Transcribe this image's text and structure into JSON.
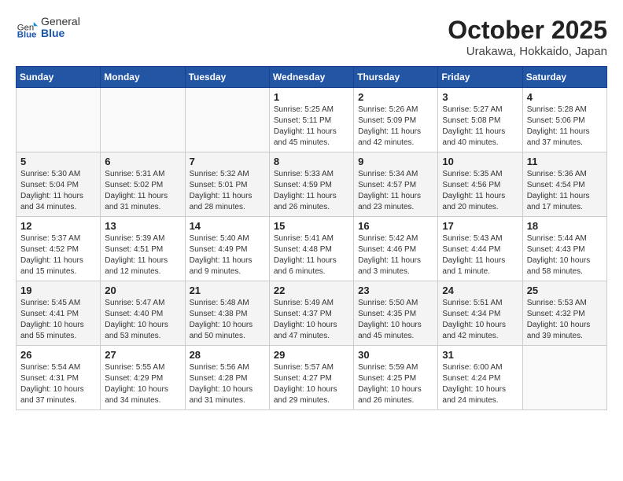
{
  "header": {
    "logo_general": "General",
    "logo_blue": "Blue",
    "title": "October 2025",
    "location": "Urakawa, Hokkaido, Japan"
  },
  "weekdays": [
    "Sunday",
    "Monday",
    "Tuesday",
    "Wednesday",
    "Thursday",
    "Friday",
    "Saturday"
  ],
  "weeks": [
    [
      {
        "day": "",
        "info": ""
      },
      {
        "day": "",
        "info": ""
      },
      {
        "day": "",
        "info": ""
      },
      {
        "day": "1",
        "info": "Sunrise: 5:25 AM\nSunset: 5:11 PM\nDaylight: 11 hours\nand 45 minutes."
      },
      {
        "day": "2",
        "info": "Sunrise: 5:26 AM\nSunset: 5:09 PM\nDaylight: 11 hours\nand 42 minutes."
      },
      {
        "day": "3",
        "info": "Sunrise: 5:27 AM\nSunset: 5:08 PM\nDaylight: 11 hours\nand 40 minutes."
      },
      {
        "day": "4",
        "info": "Sunrise: 5:28 AM\nSunset: 5:06 PM\nDaylight: 11 hours\nand 37 minutes."
      }
    ],
    [
      {
        "day": "5",
        "info": "Sunrise: 5:30 AM\nSunset: 5:04 PM\nDaylight: 11 hours\nand 34 minutes."
      },
      {
        "day": "6",
        "info": "Sunrise: 5:31 AM\nSunset: 5:02 PM\nDaylight: 11 hours\nand 31 minutes."
      },
      {
        "day": "7",
        "info": "Sunrise: 5:32 AM\nSunset: 5:01 PM\nDaylight: 11 hours\nand 28 minutes."
      },
      {
        "day": "8",
        "info": "Sunrise: 5:33 AM\nSunset: 4:59 PM\nDaylight: 11 hours\nand 26 minutes."
      },
      {
        "day": "9",
        "info": "Sunrise: 5:34 AM\nSunset: 4:57 PM\nDaylight: 11 hours\nand 23 minutes."
      },
      {
        "day": "10",
        "info": "Sunrise: 5:35 AM\nSunset: 4:56 PM\nDaylight: 11 hours\nand 20 minutes."
      },
      {
        "day": "11",
        "info": "Sunrise: 5:36 AM\nSunset: 4:54 PM\nDaylight: 11 hours\nand 17 minutes."
      }
    ],
    [
      {
        "day": "12",
        "info": "Sunrise: 5:37 AM\nSunset: 4:52 PM\nDaylight: 11 hours\nand 15 minutes."
      },
      {
        "day": "13",
        "info": "Sunrise: 5:39 AM\nSunset: 4:51 PM\nDaylight: 11 hours\nand 12 minutes."
      },
      {
        "day": "14",
        "info": "Sunrise: 5:40 AM\nSunset: 4:49 PM\nDaylight: 11 hours\nand 9 minutes."
      },
      {
        "day": "15",
        "info": "Sunrise: 5:41 AM\nSunset: 4:48 PM\nDaylight: 11 hours\nand 6 minutes."
      },
      {
        "day": "16",
        "info": "Sunrise: 5:42 AM\nSunset: 4:46 PM\nDaylight: 11 hours\nand 3 minutes."
      },
      {
        "day": "17",
        "info": "Sunrise: 5:43 AM\nSunset: 4:44 PM\nDaylight: 11 hours\nand 1 minute."
      },
      {
        "day": "18",
        "info": "Sunrise: 5:44 AM\nSunset: 4:43 PM\nDaylight: 10 hours\nand 58 minutes."
      }
    ],
    [
      {
        "day": "19",
        "info": "Sunrise: 5:45 AM\nSunset: 4:41 PM\nDaylight: 10 hours\nand 55 minutes."
      },
      {
        "day": "20",
        "info": "Sunrise: 5:47 AM\nSunset: 4:40 PM\nDaylight: 10 hours\nand 53 minutes."
      },
      {
        "day": "21",
        "info": "Sunrise: 5:48 AM\nSunset: 4:38 PM\nDaylight: 10 hours\nand 50 minutes."
      },
      {
        "day": "22",
        "info": "Sunrise: 5:49 AM\nSunset: 4:37 PM\nDaylight: 10 hours\nand 47 minutes."
      },
      {
        "day": "23",
        "info": "Sunrise: 5:50 AM\nSunset: 4:35 PM\nDaylight: 10 hours\nand 45 minutes."
      },
      {
        "day": "24",
        "info": "Sunrise: 5:51 AM\nSunset: 4:34 PM\nDaylight: 10 hours\nand 42 minutes."
      },
      {
        "day": "25",
        "info": "Sunrise: 5:53 AM\nSunset: 4:32 PM\nDaylight: 10 hours\nand 39 minutes."
      }
    ],
    [
      {
        "day": "26",
        "info": "Sunrise: 5:54 AM\nSunset: 4:31 PM\nDaylight: 10 hours\nand 37 minutes."
      },
      {
        "day": "27",
        "info": "Sunrise: 5:55 AM\nSunset: 4:29 PM\nDaylight: 10 hours\nand 34 minutes."
      },
      {
        "day": "28",
        "info": "Sunrise: 5:56 AM\nSunset: 4:28 PM\nDaylight: 10 hours\nand 31 minutes."
      },
      {
        "day": "29",
        "info": "Sunrise: 5:57 AM\nSunset: 4:27 PM\nDaylight: 10 hours\nand 29 minutes."
      },
      {
        "day": "30",
        "info": "Sunrise: 5:59 AM\nSunset: 4:25 PM\nDaylight: 10 hours\nand 26 minutes."
      },
      {
        "day": "31",
        "info": "Sunrise: 6:00 AM\nSunset: 4:24 PM\nDaylight: 10 hours\nand 24 minutes."
      },
      {
        "day": "",
        "info": ""
      }
    ]
  ]
}
